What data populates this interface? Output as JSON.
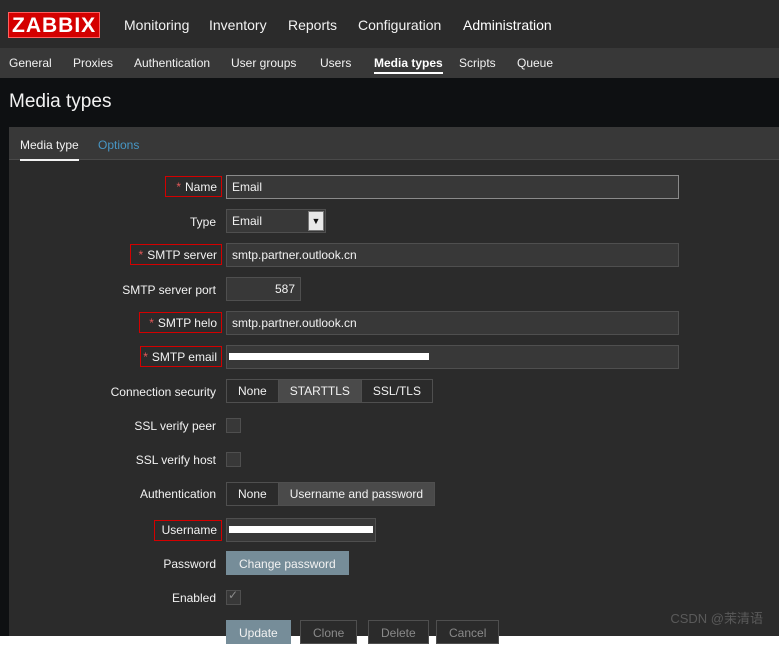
{
  "app": {
    "logo": "ZABBIX",
    "menu": [
      "Monitoring",
      "Inventory",
      "Reports",
      "Configuration",
      "Administration"
    ],
    "active_menu": "Administration"
  },
  "subnav": {
    "items": [
      "General",
      "Proxies",
      "Authentication",
      "User groups",
      "Users",
      "Media types",
      "Scripts",
      "Queue"
    ],
    "active": "Media types"
  },
  "page": {
    "title": "Media types"
  },
  "tabs": {
    "media_type": "Media type",
    "options": "Options"
  },
  "form": {
    "name_label": "Name",
    "name_value": "Email",
    "type_label": "Type",
    "type_value": "Email",
    "smtp_server_label": "SMTP server",
    "smtp_server_value": "smtp.partner.outlook.cn",
    "smtp_port_label": "SMTP server port",
    "smtp_port_value": "587",
    "smtp_helo_label": "SMTP helo",
    "smtp_helo_value": "smtp.partner.outlook.cn",
    "smtp_email_label": "SMTP email",
    "conn_security_label": "Connection security",
    "conn_security_options": [
      "None",
      "STARTTLS",
      "SSL/TLS"
    ],
    "conn_security_selected": "STARTTLS",
    "ssl_verify_peer_label": "SSL verify peer",
    "ssl_verify_host_label": "SSL verify host",
    "authentication_label": "Authentication",
    "auth_options": [
      "None",
      "Username and password"
    ],
    "auth_selected": "Username and password",
    "username_label": "Username",
    "password_label": "Password",
    "change_password": "Change password",
    "enabled_label": "Enabled",
    "enabled": true,
    "ssl_verify_peer": false,
    "ssl_verify_host": false
  },
  "buttons": {
    "update": "Update",
    "clone": "Clone",
    "delete": "Delete",
    "cancel": "Cancel"
  },
  "watermark": "CSDN @茉清语",
  "colors": {
    "brand_red": "#d40000",
    "header_bg": "#2b2b2b",
    "accent_link": "#4796c4",
    "primary_button": "#768d99"
  }
}
